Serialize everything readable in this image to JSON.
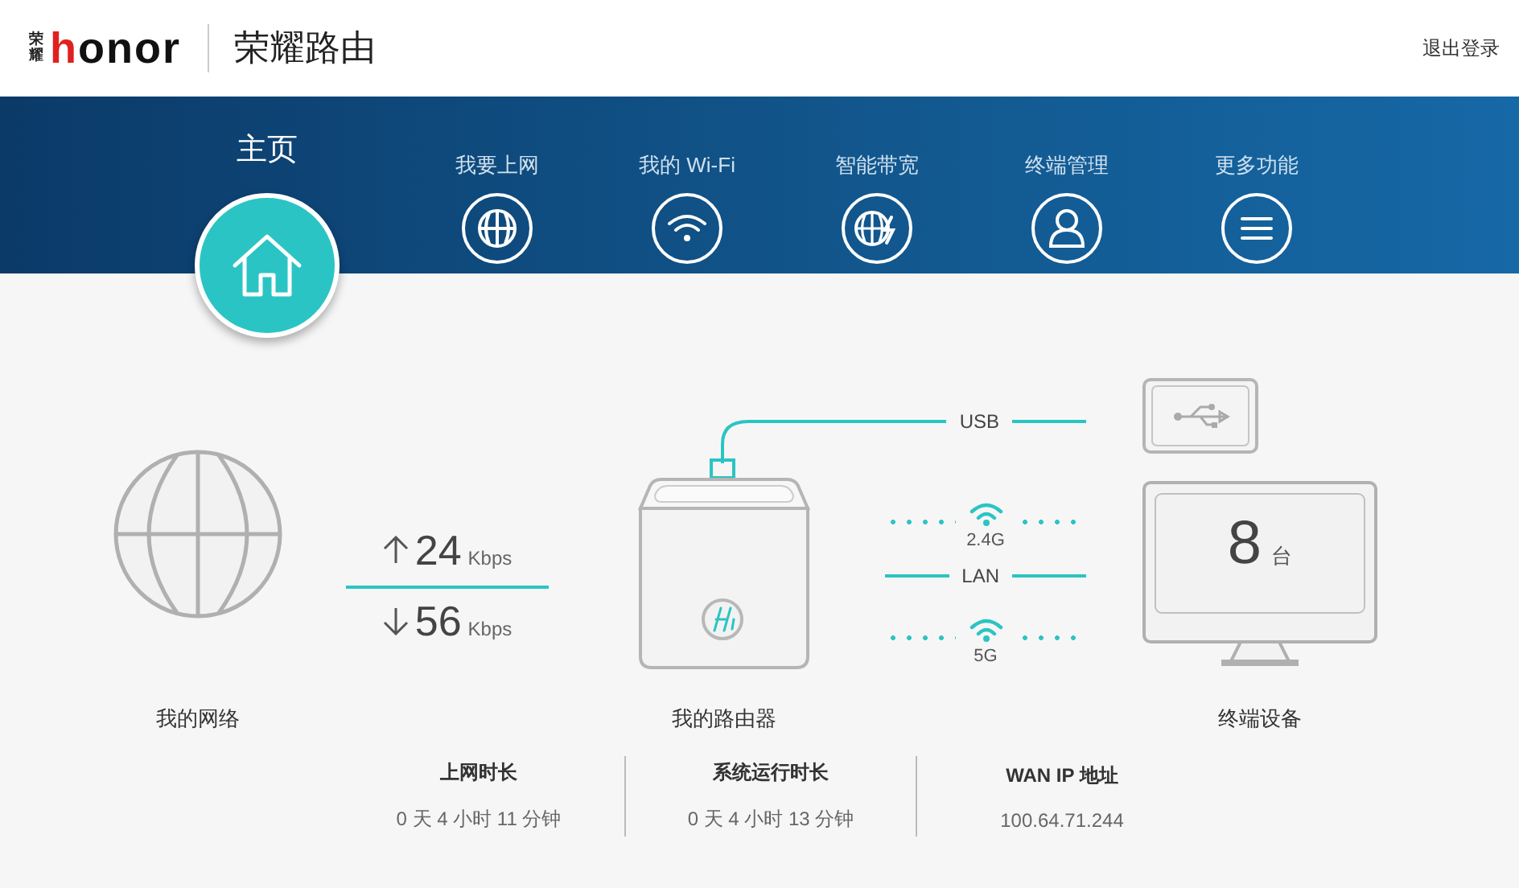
{
  "header": {
    "logo_mark": "荣耀",
    "logo": "honor",
    "title": "荣耀路由",
    "logout": "退出登录"
  },
  "nav": [
    {
      "label": "主页",
      "selected": true
    },
    {
      "label": "我要上网",
      "selected": false
    },
    {
      "label": "我的 Wi-Fi",
      "selected": false
    },
    {
      "label": "智能带宽",
      "selected": false
    },
    {
      "label": "终端管理",
      "selected": false
    },
    {
      "label": "更多功能",
      "selected": false
    }
  ],
  "network": {
    "label": "我的网络"
  },
  "speed": {
    "up": {
      "value": "24",
      "unit": "Kbps"
    },
    "down": {
      "value": "56",
      "unit": "Kbps"
    }
  },
  "router": {
    "label": "我的路由器"
  },
  "links": [
    {
      "kind": "wired",
      "label": "USB"
    },
    {
      "kind": "wireless",
      "label": "2.4G"
    },
    {
      "kind": "wired",
      "label": "LAN"
    },
    {
      "kind": "wireless",
      "label": "5G"
    }
  ],
  "devices": {
    "count": "8",
    "unit": "台",
    "label": "终端设备"
  },
  "stats": [
    {
      "title": "上网时长",
      "value": "0 天 4 小时 11 分钟"
    },
    {
      "title": "系统运行时长",
      "value": "0 天 4 小时 13 分钟"
    },
    {
      "title": "WAN IP 地址",
      "value": "100.64.71.244"
    }
  ]
}
